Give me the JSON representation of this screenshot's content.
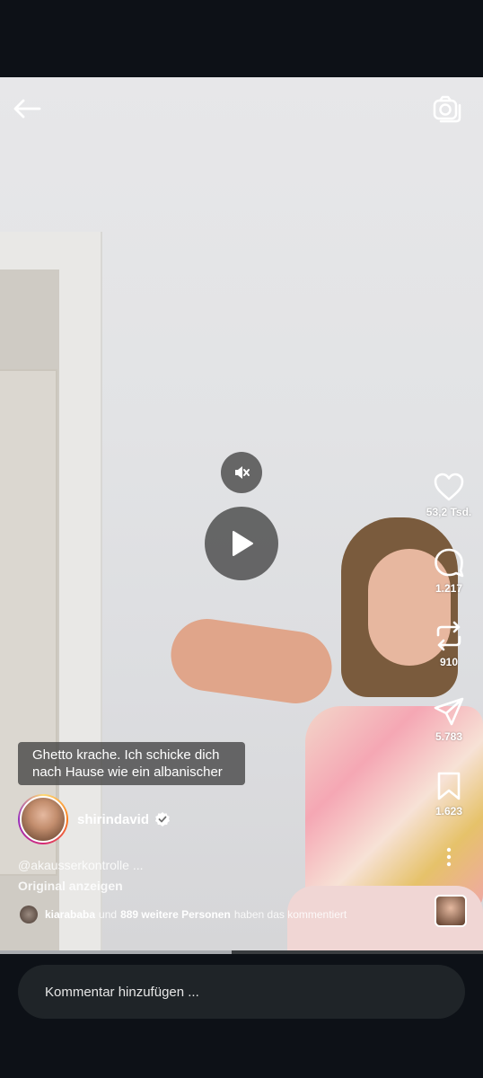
{
  "caption_text": "Ghetto krache. Ich schicke dich nach Hause wie ein albanischer",
  "actions": {
    "likes": "53,2 Tsd.",
    "comments": "1.217",
    "reposts": "910",
    "shares": "5.783",
    "saves": "1.623"
  },
  "author": {
    "username": "shirindavid",
    "mention": "@akausserkontrolle ...",
    "original_link": "Original anzeigen"
  },
  "activity": {
    "user": "kiarababa",
    "connector": "und",
    "others": "889 weitere Personen",
    "suffix": "haben das kommentiert"
  },
  "comment_input": {
    "placeholder": "Kommentar hinzufügen ..."
  },
  "progress_fraction": 0.48,
  "icons": [
    "back-arrow-icon",
    "camera-icon",
    "mute-icon",
    "play-icon",
    "heart-icon",
    "comment-icon",
    "repost-icon",
    "share-icon",
    "bookmark-icon",
    "more-icon",
    "verified-icon"
  ]
}
